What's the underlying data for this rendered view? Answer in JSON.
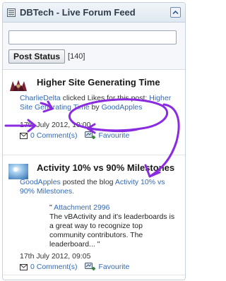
{
  "widget": {
    "title": "DBTech - Live Forum Feed"
  },
  "compose": {
    "input_value": "",
    "post_label": "Post Status",
    "char_count": "[140]"
  },
  "feed": [
    {
      "title": "Higher Site Generating Time",
      "user": "CharlieDelta",
      "action_text": "clicked Likes for this post:",
      "post_link": "Higher Site Generating Time",
      "by_text": "by",
      "author": "GoodApples",
      "date": "17th July 2012, 10:00",
      "comments": "0 Comment(s)",
      "favourite": "Favourite"
    },
    {
      "title": "Activity 10% vs 90% Milestones",
      "user": "GoodApples",
      "action_text": "posted the blog",
      "post_link": "Activity 10% vs 90% Milestones.",
      "quote_open": "\"",
      "attachment": "Attachment 2996",
      "quote_text": "The vBActivity and it's leaderboards is a great way to recognize top community contributors. The leaderboard... \"",
      "date": "17th July 2012, 09:05",
      "comments": "0 Comment(s)",
      "favourite": "Favourite"
    }
  ]
}
